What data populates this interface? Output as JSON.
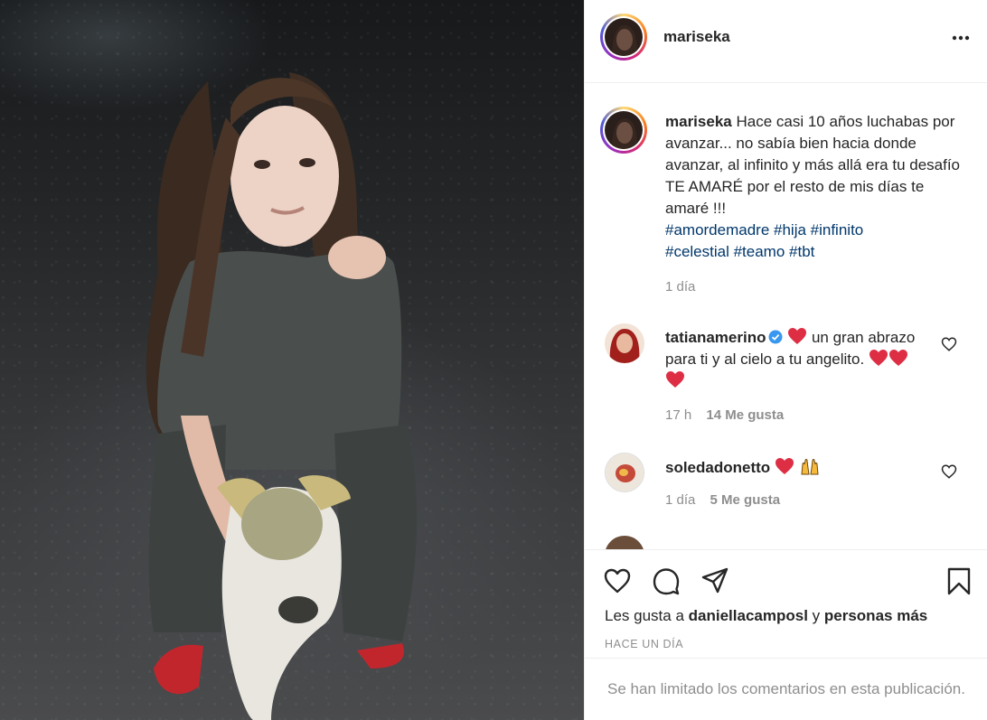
{
  "post": {
    "username": "mariseka",
    "caption": "Hace casi 10 años luchabas por avanzar... no sabía bien hacia donde avanzar, al infinito y más allá era tu desafío TE AMARÉ por el resto de mis días te amaré !!!",
    "hashtags_line1": "#amordemadre #hija #infinito",
    "hashtags_line2": "#celestial #teamo #tbt",
    "time": "1 día"
  },
  "comments": [
    {
      "username": "tatianamerino",
      "verified": true,
      "text_part1": "un gran abrazo para ti y al cielo a tu angelito.",
      "time": "17 h",
      "likes": "14 Me gusta"
    },
    {
      "username": "soledadonetto",
      "verified": false,
      "text_part1": "",
      "time": "1 día",
      "likes": "5 Me gusta"
    }
  ],
  "actions": {
    "likes_prefix": "Les gusta a",
    "liked_by_user": "daniellacamposl",
    "likes_conjunction": "y",
    "likes_others": "personas más",
    "ago": "HACE UN DÍA"
  },
  "footer": {
    "limited_text": "Se han limitado los comentarios en esta publicación."
  },
  "icons": {
    "header_more": "more-horizontal-icon",
    "heart": "heart-icon",
    "comment": "comment-icon",
    "share": "share-icon",
    "save": "bookmark-icon",
    "verified": "verified-badge-icon"
  },
  "colors": {
    "link": "#00376b",
    "verified_blue": "#3897f0",
    "secondary_text": "#8e8e8e"
  }
}
